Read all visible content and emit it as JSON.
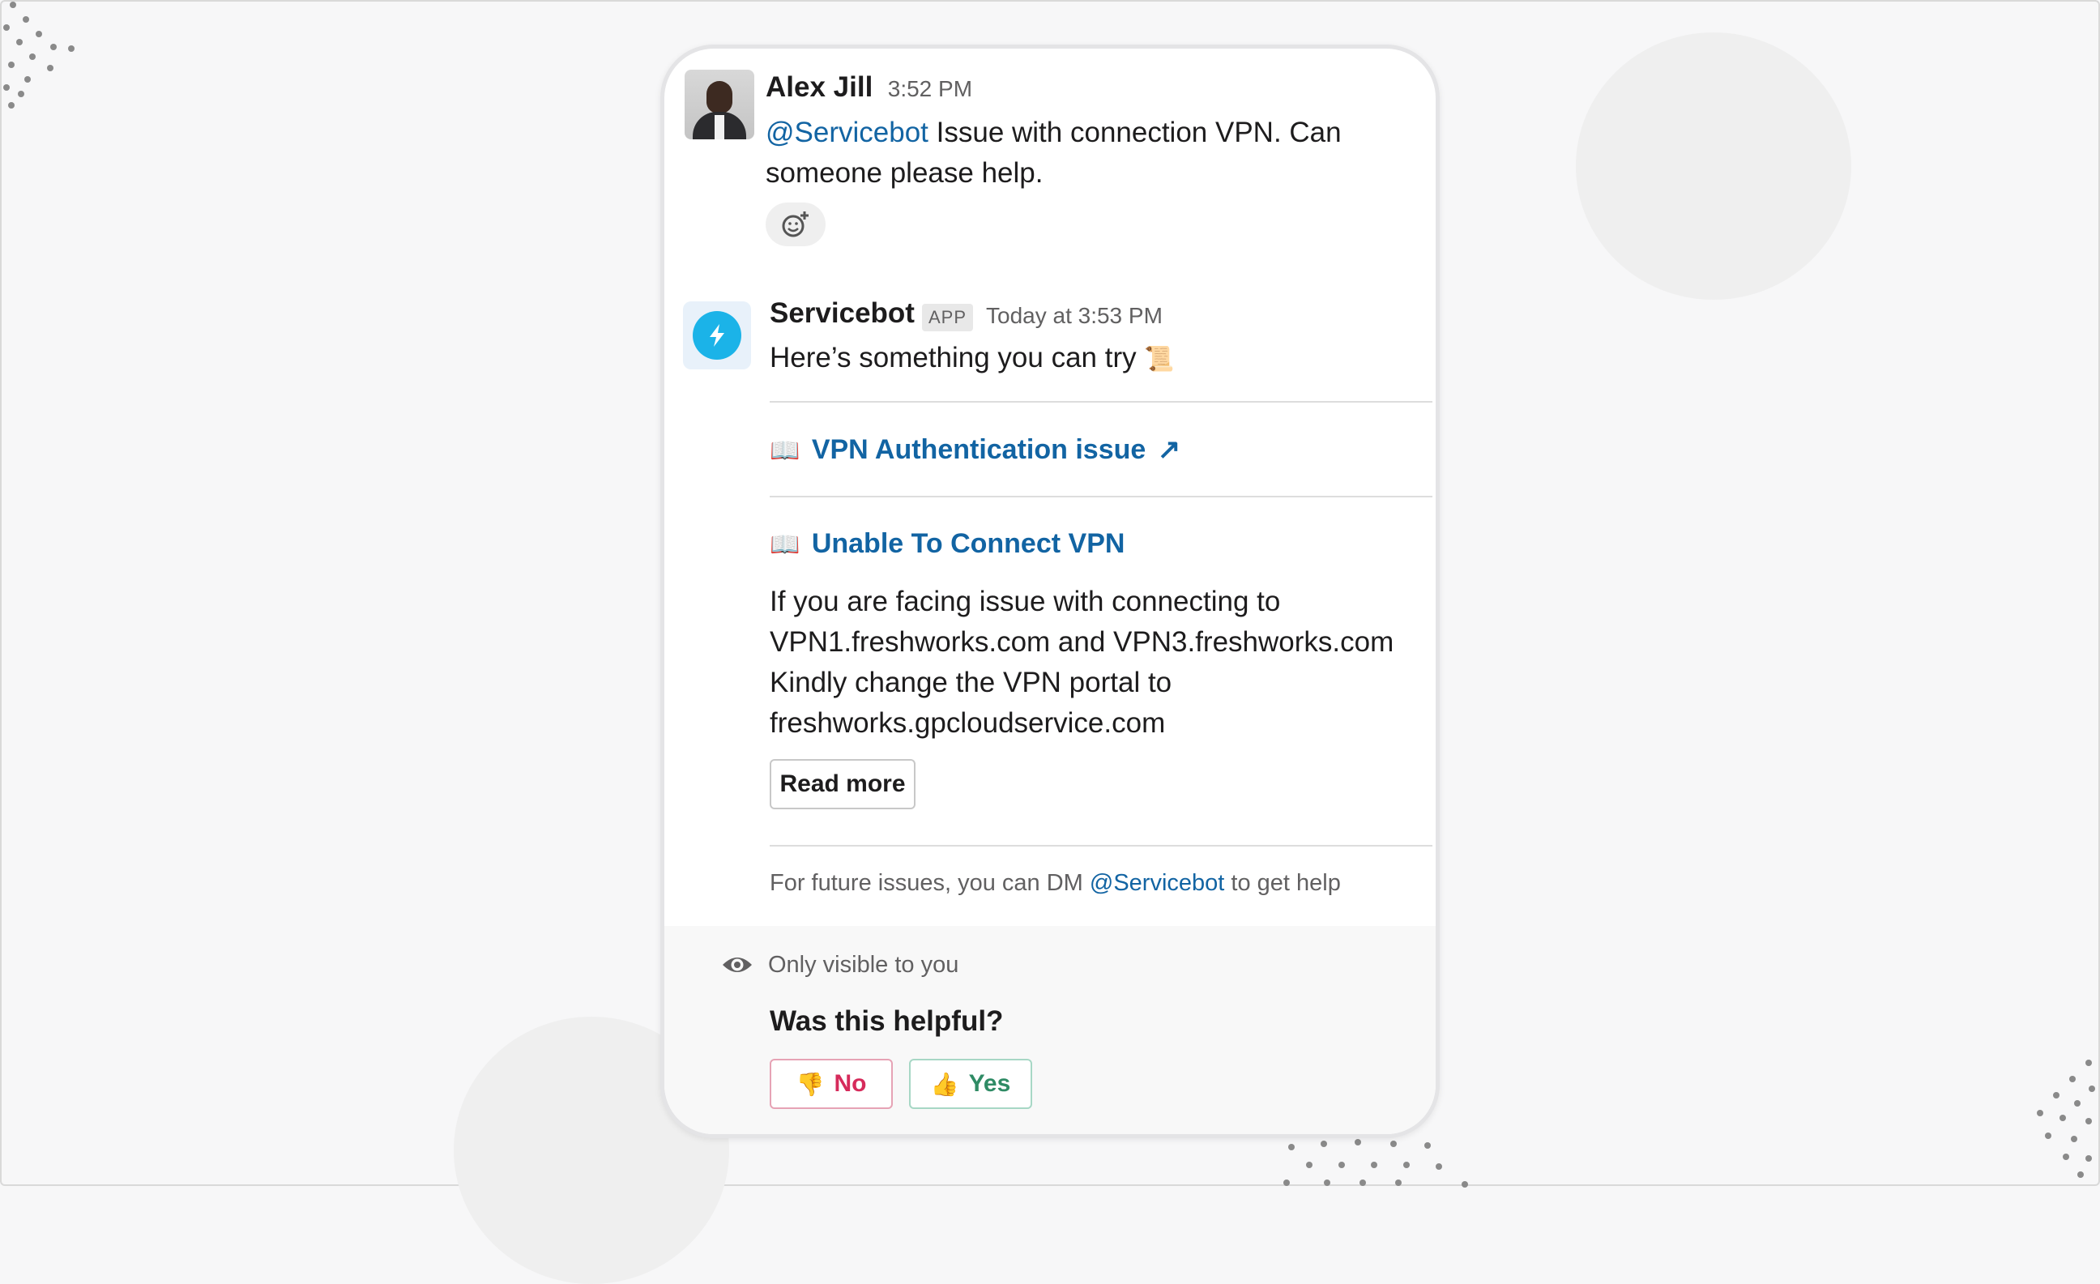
{
  "message1": {
    "author": "Alex Jill",
    "time": "3:52 PM",
    "mention": "@Servicebot",
    "text_line1": " Issue with connection VPN. Can",
    "text_line2": "someone please help."
  },
  "message2": {
    "author": "Servicebot",
    "badge": "APP",
    "time": "Today at 3:53 PM",
    "intro": "Here’s something you can try",
    "intro_emoji": "📜",
    "article1": {
      "icon": "📖",
      "title": "VPN Authentication issue",
      "external_icon": "↗"
    },
    "article2": {
      "icon": "📖",
      "title": "Unable To Connect VPN",
      "body": [
        "If you are facing issue with connecting to",
        "VPN1.freshworks.com and VPN3.freshworks.com",
        "Kindly change the VPN portal to",
        "freshworks.gpcloudservice.com"
      ],
      "read_more_label": "Read more"
    },
    "footer_prefix": "For future issues, you can DM ",
    "footer_mention": "@Servicebot",
    "footer_suffix": " to get help"
  },
  "ephemeral": {
    "visibility_text": "Only visible to you",
    "question": "Was this helpful?",
    "no": {
      "emoji": "👎",
      "label": "No"
    },
    "yes": {
      "emoji": "👍",
      "label": "Yes"
    }
  },
  "colors": {
    "mention": "#1264a3",
    "bot_icon": "#1bb3e8",
    "no_button": "#d62b5b",
    "yes_button": "#2f8b65"
  }
}
